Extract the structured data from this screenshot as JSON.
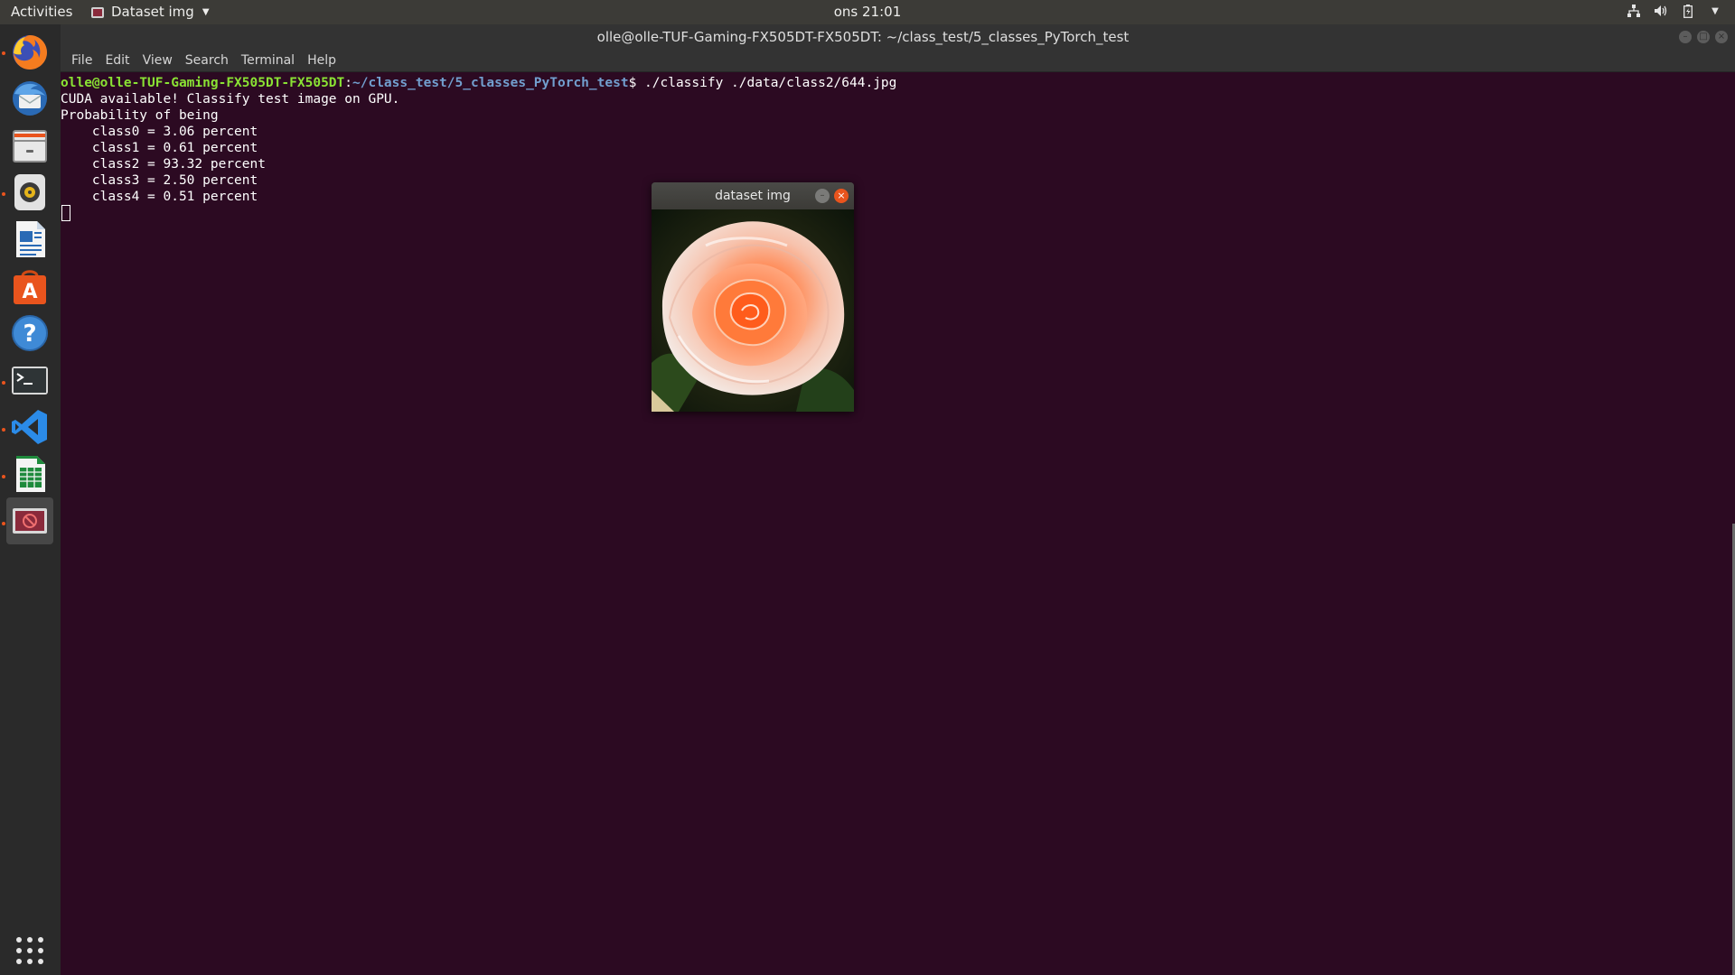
{
  "topbar": {
    "activities": "Activities",
    "app_name": "Dataset img",
    "clock": "ons 21:01",
    "tray_icons": [
      "network-icon",
      "volume-icon",
      "battery-icon",
      "system-menu-chevron-icon"
    ]
  },
  "window": {
    "title": "olle@olle-TUF-Gaming-FX505DT-FX505DT: ~/class_test/5_classes_PyTorch_test",
    "menu": [
      "File",
      "Edit",
      "View",
      "Search",
      "Terminal",
      "Help"
    ]
  },
  "terminal": {
    "prompt_user": "olle@olle-TUF-Gaming-FX505DT-FX505DT",
    "prompt_path": "~/class_test/5_classes_PyTorch_test",
    "command": "./classify ./data/class2/644.jpg",
    "output": [
      "CUDA available! Classify test image on GPU.",
      "Probability of being",
      "    class0 = 3.06 percent",
      "    class1 = 0.61 percent",
      "    class2 = 93.32 percent",
      "    class3 = 2.50 percent",
      "    class4 = 0.51 percent"
    ]
  },
  "dock": {
    "items": [
      {
        "name": "firefox-icon",
        "running": true
      },
      {
        "name": "thunderbird-icon",
        "running": false
      },
      {
        "name": "files-icon",
        "running": true
      },
      {
        "name": "rhythmbox-icon",
        "running": false
      },
      {
        "name": "libreoffice-writer-icon",
        "running": false
      },
      {
        "name": "ubuntu-software-icon",
        "running": false
      },
      {
        "name": "help-icon",
        "running": false
      },
      {
        "name": "terminal-icon",
        "running": true
      },
      {
        "name": "vscode-icon",
        "running": true
      },
      {
        "name": "libreoffice-calc-icon",
        "running": true
      },
      {
        "name": "image-window-icon",
        "running": true
      }
    ],
    "show_apps": "show-applications-icon"
  },
  "image_window": {
    "title": "dataset img",
    "image": "rose-photo"
  },
  "colors": {
    "terminal_bg": "#2c0a22",
    "prompt_user": "#8ae234",
    "prompt_path": "#729fcf",
    "accent_orange": "#e9541d"
  }
}
